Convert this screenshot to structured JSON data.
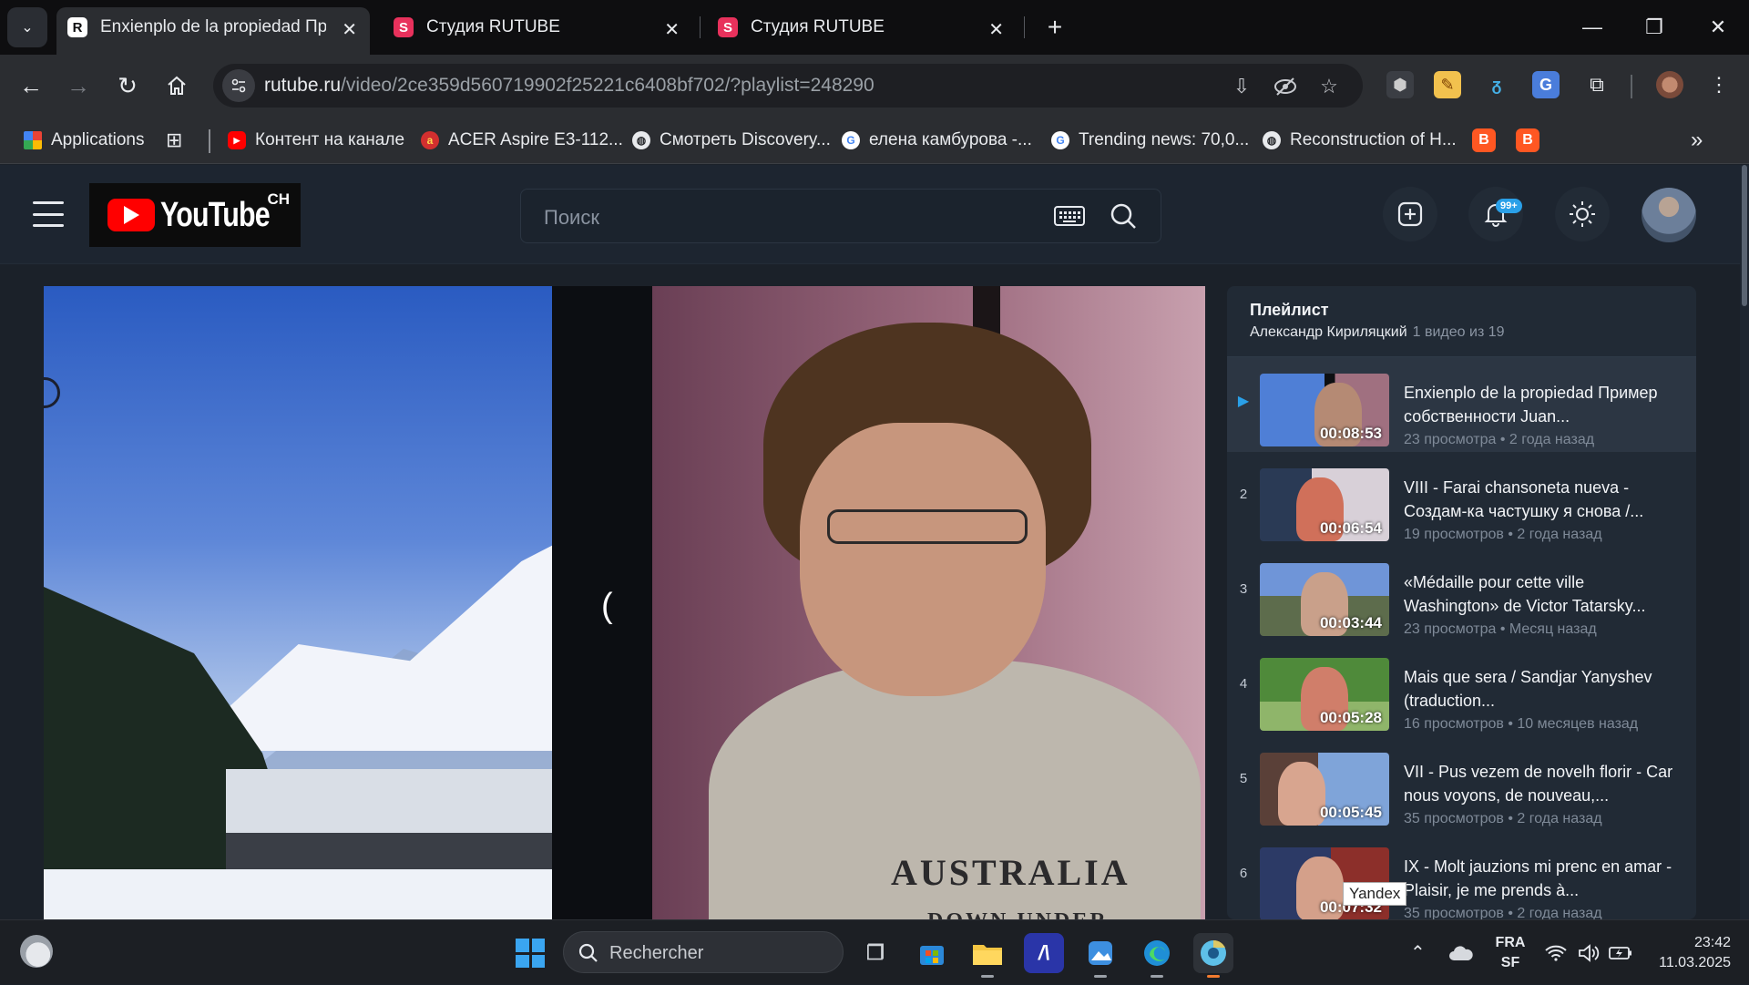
{
  "browser": {
    "tabs": [
      {
        "title": "Enxienplo de la propiedad При",
        "favicon": "rutube-icon",
        "active": true
      },
      {
        "title": "Студия RUTUBE",
        "favicon": "rutube-studio-icon",
        "active": false
      },
      {
        "title": "Студия RUTUBE",
        "favicon": "rutube-studio-icon",
        "active": false
      }
    ],
    "url_host": "rutube.ru",
    "url_path": "/video/2ce359d560719902f25221c6408bf702/?playlist=248290",
    "bookmarks": [
      {
        "label": "Applications",
        "icon": "apps-grid-icon"
      },
      {
        "label": "Контент на канале",
        "icon": "youtube-icon"
      },
      {
        "label": "ACER Aspire E3-112...",
        "icon": "acer-icon"
      },
      {
        "label": "Смотреть Discovery...",
        "icon": "globe-icon"
      },
      {
        "label": "елена камбурова -...",
        "icon": "google-icon"
      },
      {
        "label": "Trending news: 70,0...",
        "icon": "google-icon"
      },
      {
        "label": "Reconstruction of H...",
        "icon": "globe-icon"
      }
    ]
  },
  "site": {
    "logo_word": "YouTube",
    "logo_suffix": "CH",
    "search_placeholder": "Поиск",
    "notifications_badge": "99+"
  },
  "playlist": {
    "title": "Плейлист",
    "author": "Александр Кириляцкий",
    "position": "1 видео из 19",
    "items": [
      {
        "index": "▶",
        "title": "Enxienplo de la propiedad Пример собственности Juan...",
        "views": "23 просмотра",
        "ago": "2 года назад",
        "duration": "00:08:53",
        "current": true
      },
      {
        "index": "2",
        "title": "VIII - Farai chansoneta nueva - Создам-ка частушку я снова /...",
        "views": "19 просмотров",
        "ago": "2 года назад",
        "duration": "00:06:54"
      },
      {
        "index": "3",
        "title": "«Médaille pour cette ville Washington» de Victor Tatarsky...",
        "views": "23 просмотра",
        "ago": "Месяц назад",
        "duration": "00:03:44"
      },
      {
        "index": "4",
        "title": "Mais que sera / Sandjar Yanyshev (traduction...",
        "views": "16 просмотров",
        "ago": "10 месяцев назад",
        "duration": "00:05:28"
      },
      {
        "index": "5",
        "title": "VII - Pus vezem de novelh florir - Car nous voyons, de nouveau,...",
        "views": "35 просмотров",
        "ago": "2 года назад",
        "duration": "00:05:45"
      },
      {
        "index": "6",
        "title": "IX - Molt jauzions mi prenc en amar - Plaisir, je me prends à...",
        "views": "35 просмотров",
        "ago": "2 года назад",
        "duration": "00:07:32"
      }
    ]
  },
  "video": {
    "shirt_text": "AUSTRALIA",
    "shirt_subtext": "DOWN UNDER"
  },
  "tooltip": "Yandex",
  "taskbar": {
    "search_placeholder": "Rechercher",
    "lang_line1": "FRA",
    "lang_line2": "SF",
    "time": "23:42",
    "date": "11.03.2025"
  }
}
